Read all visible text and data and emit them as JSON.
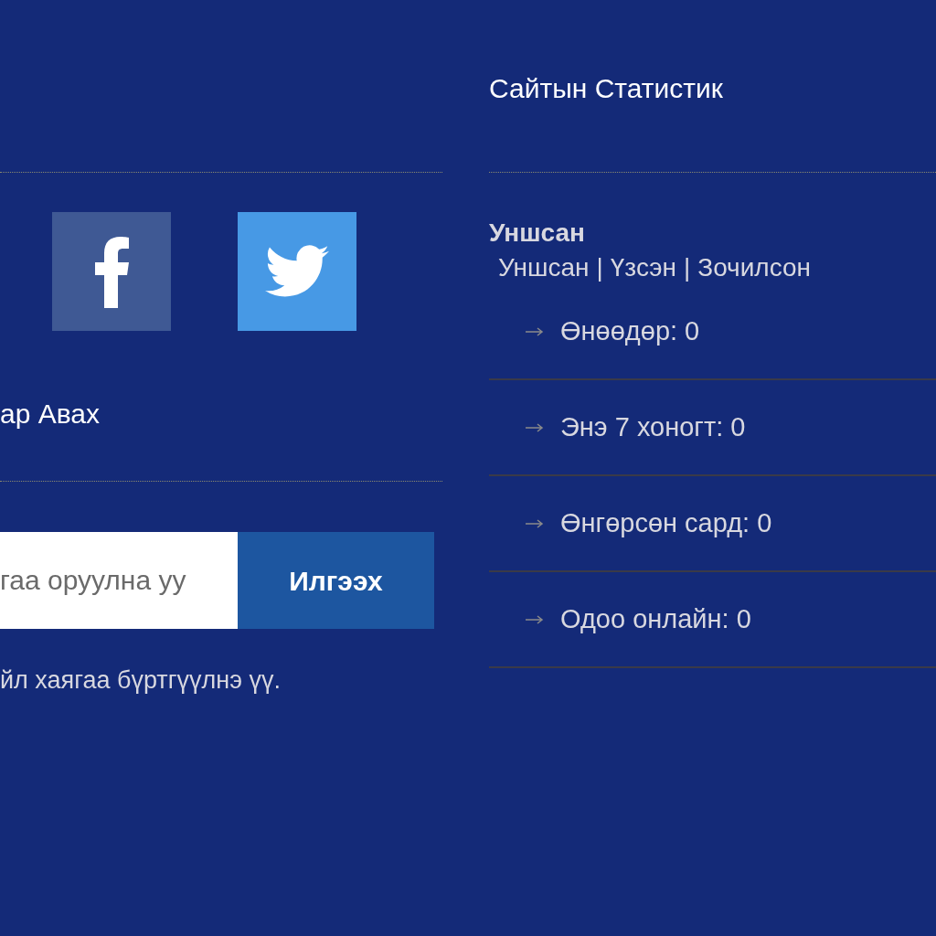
{
  "social": [
    {
      "kind": "facebook"
    },
    {
      "kind": "twitter"
    }
  ],
  "subscribe": {
    "title": "ар Авах",
    "placeholder": "гаа оруулна уу",
    "button": "Илгээх",
    "note": "йл хаягаа бүртгүүлнэ үү."
  },
  "stats": {
    "title": "Сайтын Статистик",
    "subtitle": "Уншсан",
    "separator": "|",
    "links": [
      "Уншсан",
      "Үзсэн",
      "Зочилсон"
    ],
    "rows": [
      "Өнөөдөр: 0",
      "Энэ 7 хоногт: 0",
      "Өнгөрсөн сард: 0",
      "Одоо онлайн: 0"
    ]
  }
}
